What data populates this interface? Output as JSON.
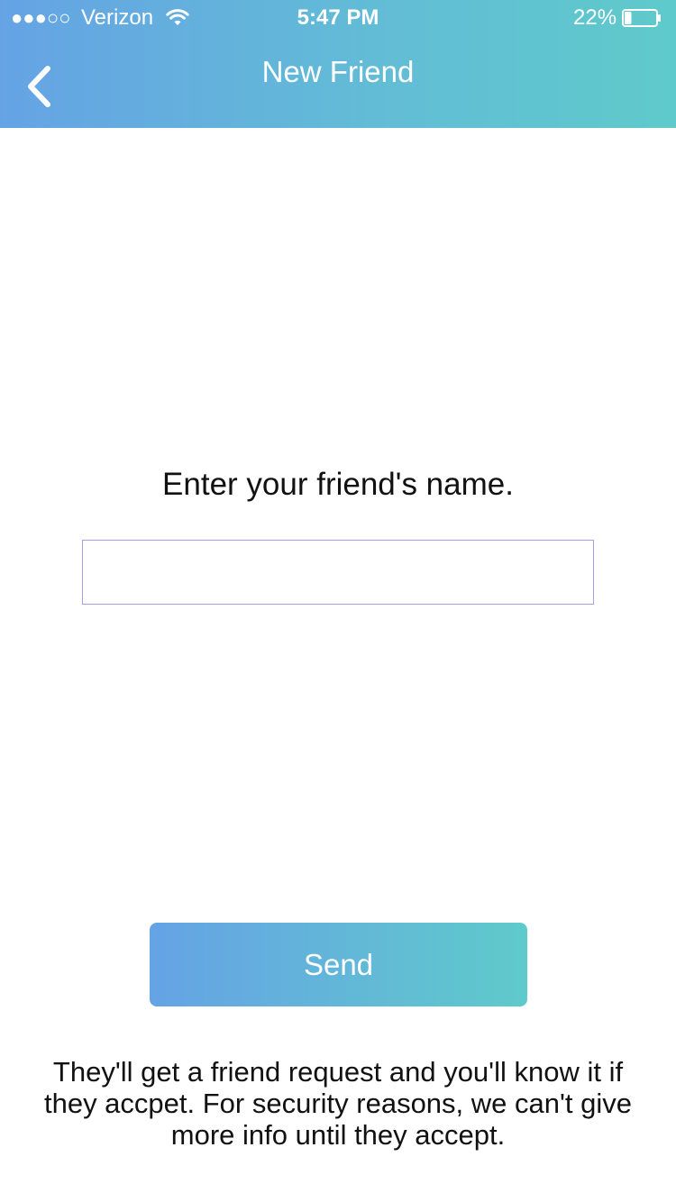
{
  "status_bar": {
    "signal": "●●●○○",
    "carrier": "Verizon",
    "wifi_icon": "wifi-icon",
    "time": "5:47 PM",
    "battery_percent": "22%",
    "battery_icon": "battery-icon",
    "battery_level": 0.22
  },
  "nav": {
    "back_icon": "chevron-left-icon",
    "title": "New Friend"
  },
  "main": {
    "prompt": "Enter your friend's name.",
    "name_input_value": "",
    "name_input_placeholder": "",
    "send_label": "Send",
    "footnote": "They'll get a friend request and you'll know it if they accpet.  For security reasons, we can't give more info until they accept."
  },
  "colors": {
    "gradient_start": "#65a3e5",
    "gradient_end": "#5fcacb",
    "input_border": "#a59fe6",
    "text": "#111111"
  }
}
